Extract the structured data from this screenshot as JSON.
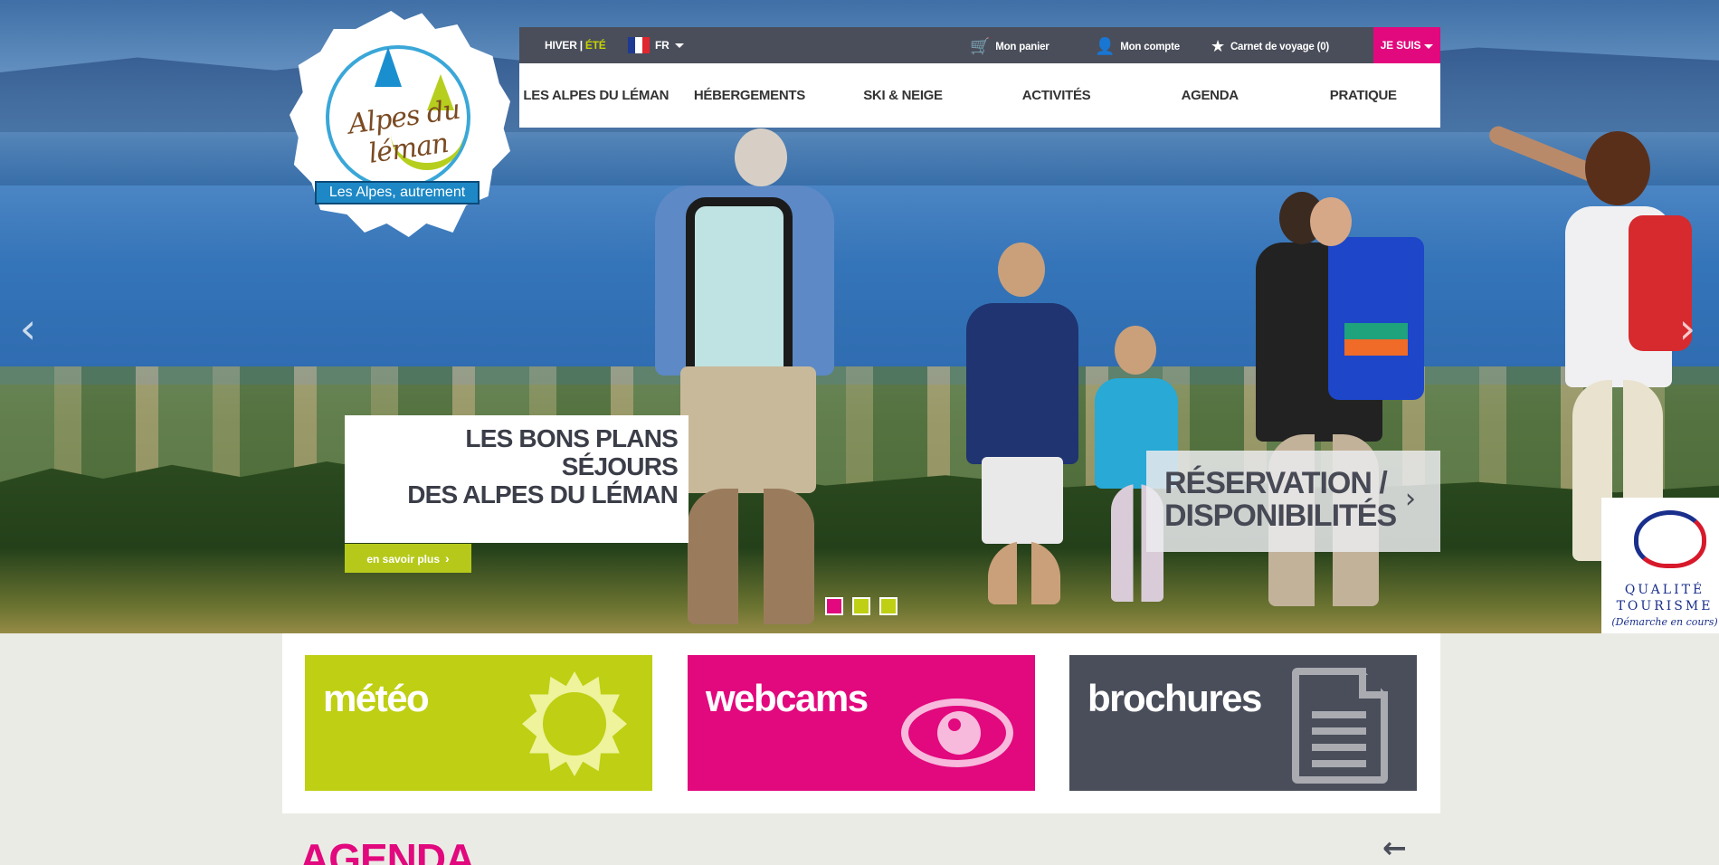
{
  "topbar": {
    "season": {
      "winter": "HIVER",
      "separator": "|",
      "summer": "ÉTÉ"
    },
    "language": "FR",
    "cart": "Mon panier",
    "account": "Mon compte",
    "trip_book": "Carnet de voyage (0)",
    "je_suis": "JE SUIS"
  },
  "logo": {
    "wordmark": "Alpes du léman",
    "tagline": "Les Alpes, autrement"
  },
  "nav": {
    "items": [
      "LES ALPES DU LÉMAN",
      "HÉBERGEMENTS",
      "SKI & NEIGE",
      "ACTIVITÉS",
      "AGENDA",
      "PRATIQUE"
    ]
  },
  "hero": {
    "promo_title_line1": "LES BONS PLANS SÉJOURS",
    "promo_title_line2": "DES ALPES DU LÉMAN",
    "promo_button": "en savoir plus",
    "reservation_line1": "RÉSERVATION /",
    "reservation_line2": "DISPONIBILITÉS",
    "slider_dots": 3,
    "active_dot": 1
  },
  "quality": {
    "line1": "QUALITÉ",
    "line2": "TOURISME",
    "sub": "(Démarche en cours)"
  },
  "tiles": [
    {
      "label": "météo",
      "icon": "sun-icon"
    },
    {
      "label": "webcams",
      "icon": "eye-icon"
    },
    {
      "label": "brochures",
      "icon": "document-icon"
    }
  ],
  "agenda": {
    "title": "AGENDA"
  },
  "colors": {
    "lime": "#bfcf13",
    "magenta": "#e2087d",
    "slate": "#4a4e5a"
  }
}
